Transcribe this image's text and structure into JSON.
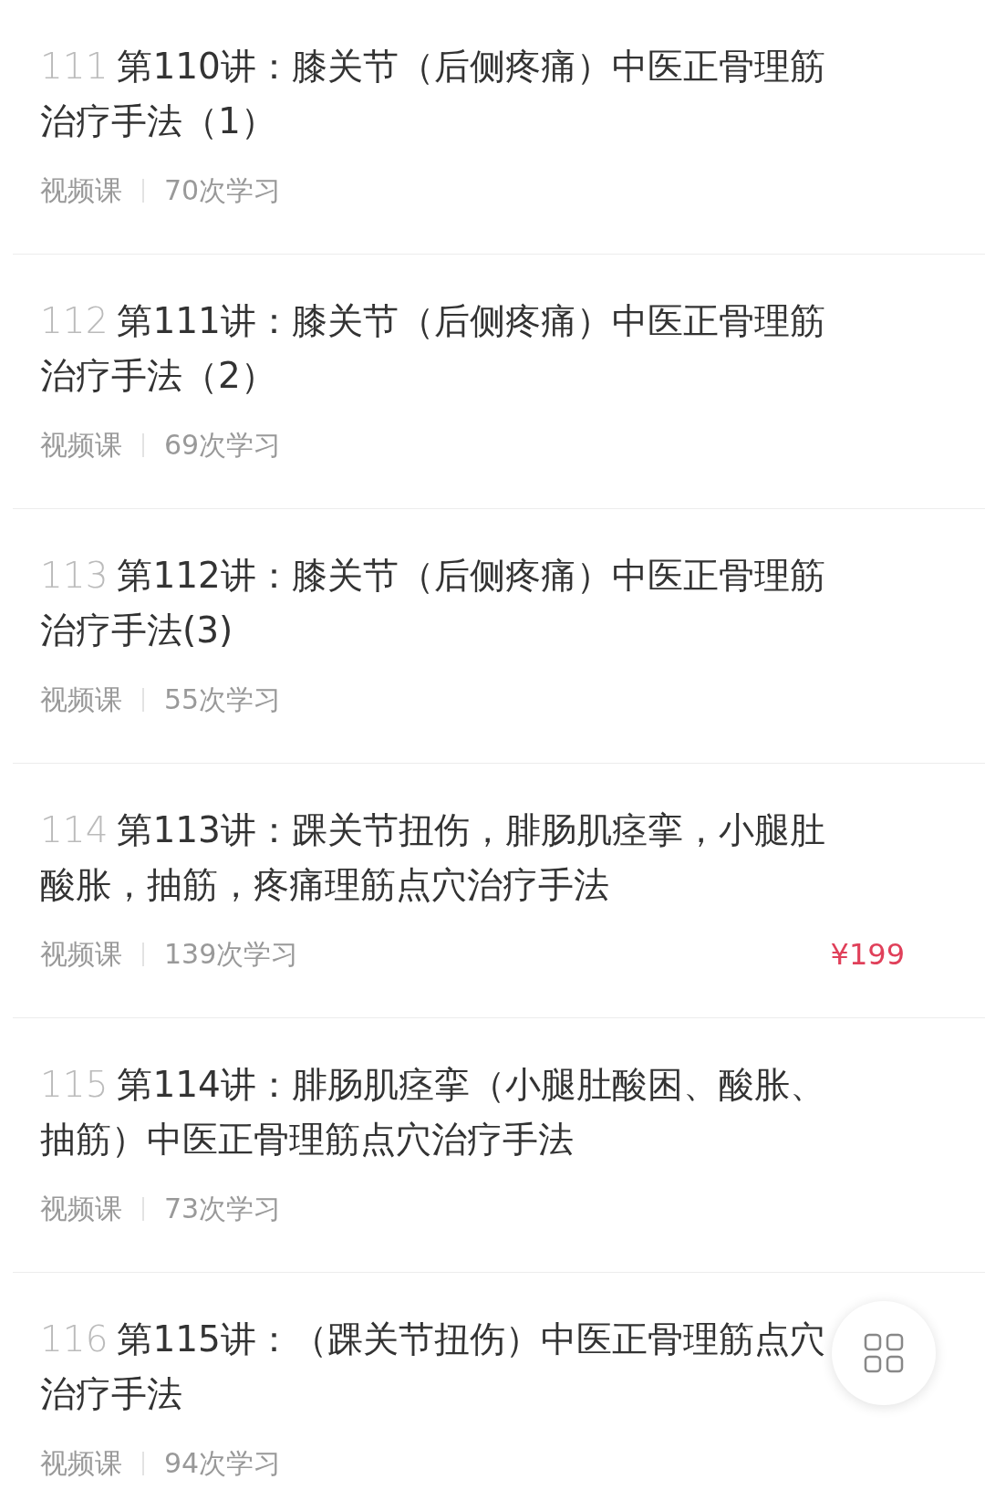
{
  "lessons": [
    {
      "number": "111",
      "title": "第110讲：膝关节（后侧疼痛）中医正骨理筋治疗手法（1）",
      "type": "视频课",
      "count": "70次学习"
    },
    {
      "number": "112",
      "title": "第111讲：膝关节（后侧疼痛）中医正骨理筋治疗手法（2）",
      "type": "视频课",
      "count": "69次学习"
    },
    {
      "number": "113",
      "title": "第112讲：膝关节（后侧疼痛）中医正骨理筋治疗手法(3)",
      "type": "视频课",
      "count": "55次学习"
    },
    {
      "number": "114",
      "title": "第113讲：踝关节扭伤，腓肠肌痉挛，小腿肚酸胀，抽筋，疼痛理筋点穴治疗手法",
      "type": "视频课",
      "count": "139次学习",
      "price": "¥199"
    },
    {
      "number": "115",
      "title": "第114讲：腓肠肌痉挛（小腿肚酸困、酸胀、抽筋）中医正骨理筋点穴治疗手法",
      "type": "视频课",
      "count": "73次学习"
    },
    {
      "number": "116",
      "title": "第115讲：（踝关节扭伤）中医正骨理筋点穴治疗手法",
      "type": "视频课",
      "count": "94次学习"
    }
  ]
}
